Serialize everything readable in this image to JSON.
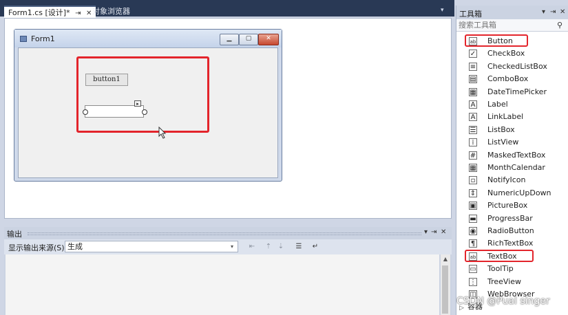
{
  "document_tabs": {
    "active_label": "Form1.cs [设计]*",
    "pin_glyph": "⇥",
    "close_glyph": "✕",
    "inactive_label": "对象浏览器"
  },
  "designer": {
    "form_title": "Form1",
    "min_glyph": "▁",
    "max_glyph": "▢",
    "close_glyph": "✕",
    "button_text": "button1",
    "smart_tag_glyph": "▸"
  },
  "output": {
    "title": "输出",
    "show_source_label": "显示输出来源(S):",
    "source_value": "生成",
    "pin_glyph": "⇥",
    "close_glyph": "✕",
    "dropdown_glyph": "▾"
  },
  "toolbox": {
    "title": "工具箱",
    "search_placeholder": "搜索工具箱",
    "pin_glyph": "⇥",
    "close_glyph": "✕",
    "items": [
      {
        "label": "Button",
        "icon": "ab"
      },
      {
        "label": "CheckBox",
        "icon": "✓"
      },
      {
        "label": "CheckedListBox",
        "icon": "≡"
      },
      {
        "label": "ComboBox",
        "icon": "▤"
      },
      {
        "label": "DateTimePicker",
        "icon": "▦"
      },
      {
        "label": "Label",
        "icon": "A"
      },
      {
        "label": "LinkLabel",
        "icon": "A"
      },
      {
        "label": "ListBox",
        "icon": "☰"
      },
      {
        "label": "ListView",
        "icon": "⁞"
      },
      {
        "label": "MaskedTextBox",
        "icon": "#"
      },
      {
        "label": "MonthCalendar",
        "icon": "▦"
      },
      {
        "label": "NotifyIcon",
        "icon": "▫"
      },
      {
        "label": "NumericUpDown",
        "icon": "⇕"
      },
      {
        "label": "PictureBox",
        "icon": "▣"
      },
      {
        "label": "ProgressBar",
        "icon": "▬"
      },
      {
        "label": "RadioButton",
        "icon": "◉"
      },
      {
        "label": "RichTextBox",
        "icon": "¶"
      },
      {
        "label": "TextBox",
        "icon": "ab"
      },
      {
        "label": "ToolTip",
        "icon": "▭"
      },
      {
        "label": "TreeView",
        "icon": "⋮"
      },
      {
        "label": "WebBrowser",
        "icon": "◫"
      }
    ],
    "collapsed_group": "容器",
    "tree_caret": "▷"
  },
  "watermark": "CSDN @Pual singer",
  "colors": {
    "highlight_red": "#e3242b",
    "tab_strip": "#293955",
    "panel_bg": "#cbd3e2"
  }
}
